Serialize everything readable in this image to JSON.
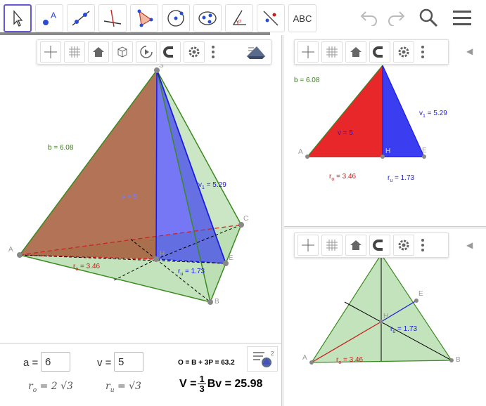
{
  "toolbar": {
    "text_tool_label": "ABC"
  },
  "view3d": {
    "labels": {
      "S": "S",
      "A": "A",
      "B": "B",
      "C": "C",
      "E": "E",
      "H": "H",
      "b": "b = 6.08",
      "v1": "v",
      "v1_sub": "1",
      "v1_val": " = 5.29",
      "v": "v = 5",
      "ro": "r",
      "ro_sub": "o",
      "ro_val": " = 3.46",
      "ru": "r",
      "ru_sub": "u",
      "ru_val": " = 1.73"
    }
  },
  "view_side": {
    "labels": {
      "b": "b = 6.08",
      "v1": "v",
      "v1_sub": "1",
      "v1_val": " = 5.29",
      "v": "v = 5",
      "A": "A",
      "H": "H",
      "E": "E",
      "ro": "r",
      "ro_sub": "o",
      "ro_val": " = 3.46",
      "ru": "r",
      "ru_sub": "u",
      "ru_val": " = 1.73"
    }
  },
  "view_base": {
    "labels": {
      "E": "E",
      "H": "H",
      "A": "A",
      "B": "B",
      "ro": "r",
      "ro_sub": "o",
      "ro_val": " = 3.46",
      "ru": "r",
      "ru_sub": "u",
      "ru_val": " = 1.73"
    }
  },
  "algebra": {
    "a_label": "a =",
    "a_value": "6",
    "v_label": "v =",
    "v_value": "5",
    "surface_formula": "O = B + 3P = 63.2",
    "ro_formula": "r",
    "ro_sub": "o",
    "ro_rhs": " = 2 √3",
    "ru_formula": "r",
    "ru_sub": "u",
    "ru_rhs": " = √3",
    "volume_lhs": "V = ",
    "volume_num": "1",
    "volume_den": "3",
    "volume_rhs": " Bv = 25.98"
  },
  "colors": {
    "accent": "#6557d2",
    "red_face": "#e8272b",
    "blue_face": "#3b3df0",
    "green_face": "#b9deb0",
    "green_edge": "#3a8a1f",
    "blue_edge": "#1a1ae6",
    "red_edge": "#c8201e"
  }
}
